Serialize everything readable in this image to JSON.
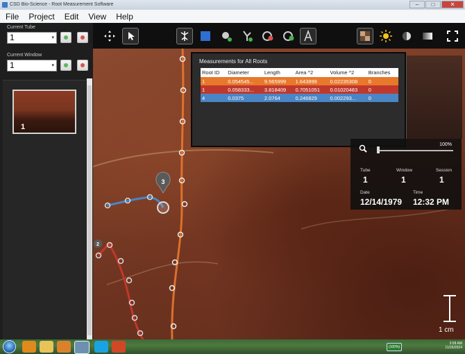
{
  "window": {
    "title": "CSD Bio-Science - Root Measurement Software"
  },
  "menu": [
    "File",
    "Project",
    "Edit",
    "View",
    "Help"
  ],
  "left_panel": {
    "current_tube_label": "Current Tube",
    "current_tube_value": "1",
    "current_window_label": "Current Window",
    "current_window_value": "1",
    "thumbnail_label": "1"
  },
  "measurements": {
    "title": "Measurements for All Roots",
    "columns": [
      "Root ID",
      "Diameter",
      "Length",
      "Area ^2",
      "Volume ^2",
      "Branches"
    ],
    "rows": [
      [
        "1",
        "0.054545...",
        "9.565999",
        "1.643899",
        "0.02235308",
        "0"
      ],
      [
        "1",
        "0.058333...",
        "3.818409",
        "0.7051051",
        "0.01020483",
        "0"
      ],
      [
        "4",
        "0.0375",
        "2.0764",
        "0.246829",
        "0.002293...",
        "0"
      ]
    ],
    "row_colors": [
      "#e8782b",
      "#c0382c",
      "#4a86c5"
    ]
  },
  "info_panel": {
    "zoom": "100%",
    "tube_label": "Tube",
    "tube_value": "1",
    "window_label": "Window",
    "window_value": "1",
    "session_label": "Session",
    "session_value": "1",
    "date_label": "Date",
    "date_value": "12/14/1979",
    "time_label": "Time",
    "time_value": "12:32 PM"
  },
  "markers": {
    "root_marker_3": "3",
    "root_marker_2": "2"
  },
  "scale": {
    "label": "1 cm"
  },
  "taskbar": {
    "battery": "(100%)",
    "clock_time": "3:58 AM",
    "clock_date": "11/26/2024"
  }
}
